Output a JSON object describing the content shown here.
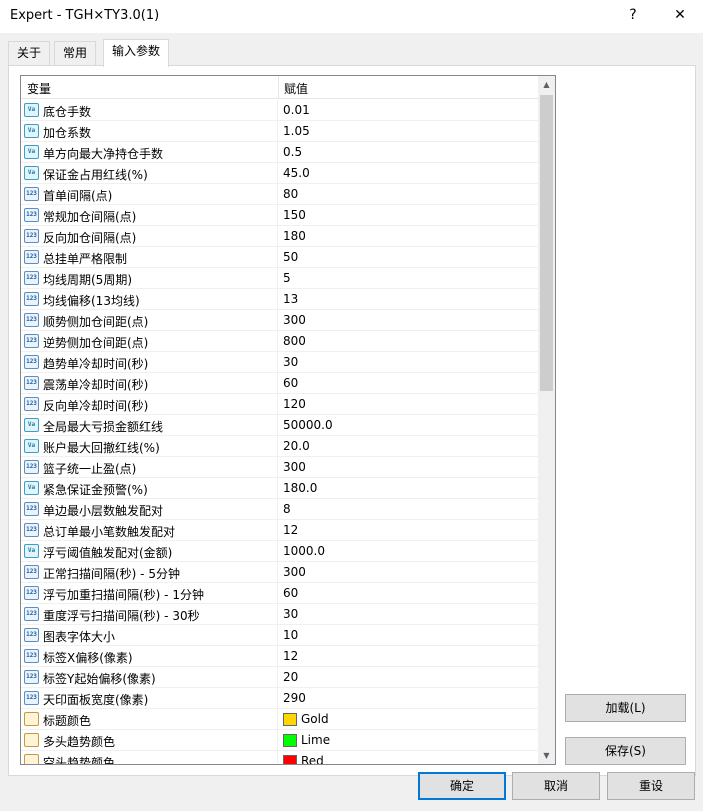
{
  "window": {
    "title": "Expert - TGH×TY3.0(1)",
    "help": "?",
    "close": "✕"
  },
  "tabs": [
    {
      "label": "关于"
    },
    {
      "label": "常用"
    },
    {
      "label": "输入参数"
    }
  ],
  "table": {
    "col_variable": "变量",
    "col_value": "赋值",
    "rows": [
      {
        "icon": "v",
        "name": "底仓手数",
        "value": "0.01"
      },
      {
        "icon": "v",
        "name": "加仓系数",
        "value": "1.05"
      },
      {
        "icon": "v",
        "name": "单方向最大净持仓手数",
        "value": "0.5"
      },
      {
        "icon": "v",
        "name": "保证金占用红线(%)",
        "value": "45.0"
      },
      {
        "icon": "i",
        "name": "首单间隔(点)",
        "value": "80"
      },
      {
        "icon": "i",
        "name": "常规加仓间隔(点)",
        "value": "150"
      },
      {
        "icon": "i",
        "name": "反向加仓间隔(点)",
        "value": "180"
      },
      {
        "icon": "i",
        "name": "总挂单严格限制",
        "value": "50"
      },
      {
        "icon": "i",
        "name": "均线周期(5周期)",
        "value": "5"
      },
      {
        "icon": "i",
        "name": "均线偏移(13均线)",
        "value": "13"
      },
      {
        "icon": "i",
        "name": "顺势侧加仓间距(点)",
        "value": "300"
      },
      {
        "icon": "i",
        "name": "逆势侧加仓间距(点)",
        "value": "800"
      },
      {
        "icon": "i",
        "name": "趋势单冷却时间(秒)",
        "value": "30"
      },
      {
        "icon": "i",
        "name": "震荡单冷却时间(秒)",
        "value": "60"
      },
      {
        "icon": "i",
        "name": "反向单冷却时间(秒)",
        "value": "120"
      },
      {
        "icon": "v",
        "name": "全局最大亏损金额红线",
        "value": "50000.0"
      },
      {
        "icon": "v",
        "name": "账户最大回撤红线(%)",
        "value": "20.0"
      },
      {
        "icon": "i",
        "name": "篮子统一止盈(点)",
        "value": "300"
      },
      {
        "icon": "v",
        "name": "紧急保证金预警(%)",
        "value": "180.0"
      },
      {
        "icon": "i",
        "name": "单边最小层数触发配对",
        "value": "8"
      },
      {
        "icon": "i",
        "name": "总订单最小笔数触发配对",
        "value": "12"
      },
      {
        "icon": "v",
        "name": "浮亏阈值触发配对(金额)",
        "value": "1000.0"
      },
      {
        "icon": "i",
        "name": "正常扫描间隔(秒) - 5分钟",
        "value": "300"
      },
      {
        "icon": "i",
        "name": "浮亏加重扫描间隔(秒) - 1分钟",
        "value": "60"
      },
      {
        "icon": "i",
        "name": "重度浮亏扫描间隔(秒) - 30秒",
        "value": "30"
      },
      {
        "icon": "i",
        "name": "图表字体大小",
        "value": "10"
      },
      {
        "icon": "i",
        "name": "标签X偏移(像素)",
        "value": "12"
      },
      {
        "icon": "i",
        "name": "标签Y起始偏移(像素)",
        "value": "20"
      },
      {
        "icon": "i",
        "name": "天印面板宽度(像素)",
        "value": "290"
      },
      {
        "icon": "c",
        "name": "标题颜色",
        "value": "Gold",
        "color": "#ffd700"
      },
      {
        "icon": "c",
        "name": "多头趋势颜色",
        "value": "Lime",
        "color": "#00ff00"
      },
      {
        "icon": "c",
        "name": "空头趋势颜色",
        "value": "Red",
        "color": "#ff0000"
      }
    ]
  },
  "buttons": {
    "load": "加载(L)",
    "save": "保存(S)",
    "ok": "确定",
    "cancel": "取消",
    "reset": "重设"
  }
}
